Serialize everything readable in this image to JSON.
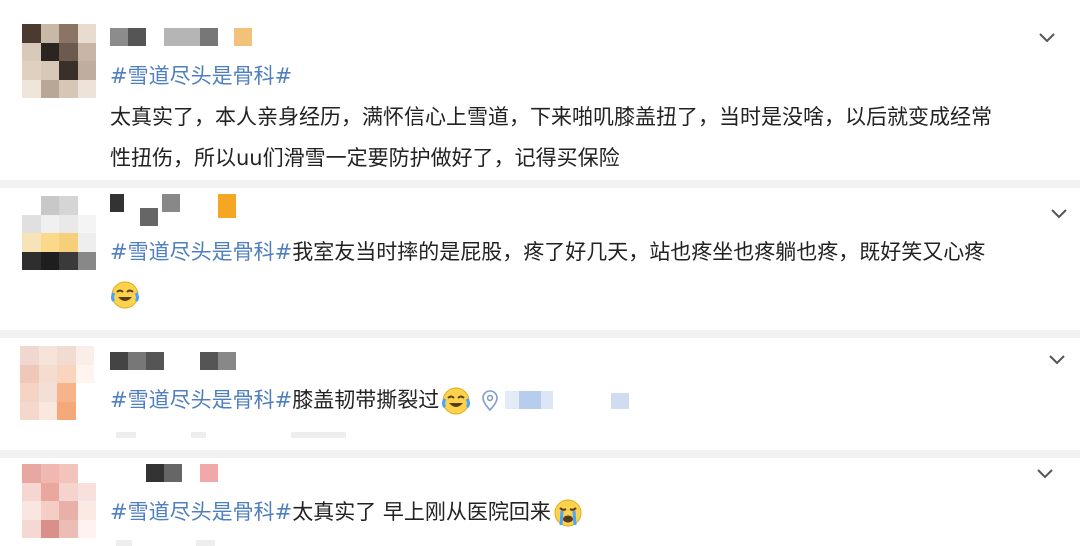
{
  "comments": [
    {
      "hashtag": "#雪道尽头是骨科#",
      "body_line1": "太真实了，本人亲身经历，满怀信心上雪道，下来啪叽膝盖扭了，当时是没啥，以后就变成经常",
      "body_line2": "性扭伤，所以uu们滑雪一定要防护做好了，记得买保险",
      "expand_icon": "chevron-down-icon"
    },
    {
      "hashtag": "#雪道尽头是骨科#",
      "body": "我室友当时摔的是屁股，疼了好几天，站也疼坐也疼躺也疼，既好笑又心疼",
      "emoji": "laughing-tears-emoji",
      "expand_icon": "chevron-down-icon"
    },
    {
      "hashtag": "#雪道尽头是骨科#",
      "body": "膝盖韧带撕裂过",
      "emoji": "laughing-tears-emoji",
      "location_icon": "location-pin-icon",
      "expand_icon": "chevron-down-icon"
    },
    {
      "hashtag": "#雪道尽头是骨科#",
      "body": "太真实了 早上刚从医院回来",
      "emoji": "crying-emoji",
      "expand_icon": "chevron-down-icon"
    }
  ],
  "colors": {
    "hashtag": "#4f7fc0",
    "text": "#222222",
    "divider": "#f2f2f2"
  }
}
